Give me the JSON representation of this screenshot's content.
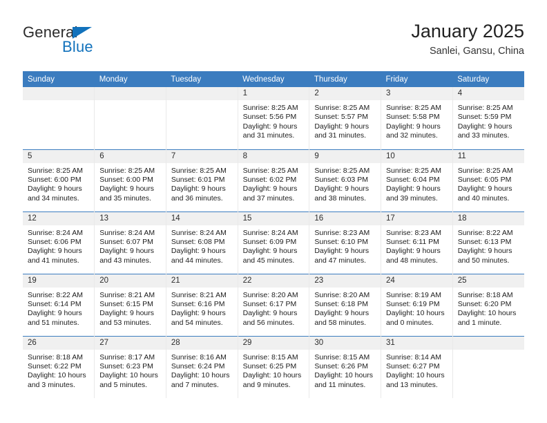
{
  "logo": {
    "text_primary": "General",
    "text_secondary": "Blue",
    "triangle_color": "#1272bc",
    "primary_color": "#2b2b2b"
  },
  "header": {
    "title": "January 2025",
    "subtitle": "Sanlei, Gansu, China"
  },
  "theme": {
    "header_blue": "#3b7cbf",
    "daynum_band": "#f0f0f0",
    "cell_divider": "#e9e9e9"
  },
  "weekday_headers": [
    "Sunday",
    "Monday",
    "Tuesday",
    "Wednesday",
    "Thursday",
    "Friday",
    "Saturday"
  ],
  "weeks": [
    [
      {
        "day": "",
        "sunrise": "",
        "sunset": "",
        "daylight1": "",
        "daylight2": "",
        "empty": true
      },
      {
        "day": "",
        "sunrise": "",
        "sunset": "",
        "daylight1": "",
        "daylight2": "",
        "empty": true
      },
      {
        "day": "",
        "sunrise": "",
        "sunset": "",
        "daylight1": "",
        "daylight2": "",
        "empty": true
      },
      {
        "day": "1",
        "sunrise": "Sunrise: 8:25 AM",
        "sunset": "Sunset: 5:56 PM",
        "daylight1": "Daylight: 9 hours",
        "daylight2": "and 31 minutes."
      },
      {
        "day": "2",
        "sunrise": "Sunrise: 8:25 AM",
        "sunset": "Sunset: 5:57 PM",
        "daylight1": "Daylight: 9 hours",
        "daylight2": "and 31 minutes."
      },
      {
        "day": "3",
        "sunrise": "Sunrise: 8:25 AM",
        "sunset": "Sunset: 5:58 PM",
        "daylight1": "Daylight: 9 hours",
        "daylight2": "and 32 minutes."
      },
      {
        "day": "4",
        "sunrise": "Sunrise: 8:25 AM",
        "sunset": "Sunset: 5:59 PM",
        "daylight1": "Daylight: 9 hours",
        "daylight2": "and 33 minutes."
      }
    ],
    [
      {
        "day": "5",
        "sunrise": "Sunrise: 8:25 AM",
        "sunset": "Sunset: 6:00 PM",
        "daylight1": "Daylight: 9 hours",
        "daylight2": "and 34 minutes."
      },
      {
        "day": "6",
        "sunrise": "Sunrise: 8:25 AM",
        "sunset": "Sunset: 6:00 PM",
        "daylight1": "Daylight: 9 hours",
        "daylight2": "and 35 minutes."
      },
      {
        "day": "7",
        "sunrise": "Sunrise: 8:25 AM",
        "sunset": "Sunset: 6:01 PM",
        "daylight1": "Daylight: 9 hours",
        "daylight2": "and 36 minutes."
      },
      {
        "day": "8",
        "sunrise": "Sunrise: 8:25 AM",
        "sunset": "Sunset: 6:02 PM",
        "daylight1": "Daylight: 9 hours",
        "daylight2": "and 37 minutes."
      },
      {
        "day": "9",
        "sunrise": "Sunrise: 8:25 AM",
        "sunset": "Sunset: 6:03 PM",
        "daylight1": "Daylight: 9 hours",
        "daylight2": "and 38 minutes."
      },
      {
        "day": "10",
        "sunrise": "Sunrise: 8:25 AM",
        "sunset": "Sunset: 6:04 PM",
        "daylight1": "Daylight: 9 hours",
        "daylight2": "and 39 minutes."
      },
      {
        "day": "11",
        "sunrise": "Sunrise: 8:25 AM",
        "sunset": "Sunset: 6:05 PM",
        "daylight1": "Daylight: 9 hours",
        "daylight2": "and 40 minutes."
      }
    ],
    [
      {
        "day": "12",
        "sunrise": "Sunrise: 8:24 AM",
        "sunset": "Sunset: 6:06 PM",
        "daylight1": "Daylight: 9 hours",
        "daylight2": "and 41 minutes."
      },
      {
        "day": "13",
        "sunrise": "Sunrise: 8:24 AM",
        "sunset": "Sunset: 6:07 PM",
        "daylight1": "Daylight: 9 hours",
        "daylight2": "and 43 minutes."
      },
      {
        "day": "14",
        "sunrise": "Sunrise: 8:24 AM",
        "sunset": "Sunset: 6:08 PM",
        "daylight1": "Daylight: 9 hours",
        "daylight2": "and 44 minutes."
      },
      {
        "day": "15",
        "sunrise": "Sunrise: 8:24 AM",
        "sunset": "Sunset: 6:09 PM",
        "daylight1": "Daylight: 9 hours",
        "daylight2": "and 45 minutes."
      },
      {
        "day": "16",
        "sunrise": "Sunrise: 8:23 AM",
        "sunset": "Sunset: 6:10 PM",
        "daylight1": "Daylight: 9 hours",
        "daylight2": "and 47 minutes."
      },
      {
        "day": "17",
        "sunrise": "Sunrise: 8:23 AM",
        "sunset": "Sunset: 6:11 PM",
        "daylight1": "Daylight: 9 hours",
        "daylight2": "and 48 minutes."
      },
      {
        "day": "18",
        "sunrise": "Sunrise: 8:22 AM",
        "sunset": "Sunset: 6:13 PM",
        "daylight1": "Daylight: 9 hours",
        "daylight2": "and 50 minutes."
      }
    ],
    [
      {
        "day": "19",
        "sunrise": "Sunrise: 8:22 AM",
        "sunset": "Sunset: 6:14 PM",
        "daylight1": "Daylight: 9 hours",
        "daylight2": "and 51 minutes."
      },
      {
        "day": "20",
        "sunrise": "Sunrise: 8:21 AM",
        "sunset": "Sunset: 6:15 PM",
        "daylight1": "Daylight: 9 hours",
        "daylight2": "and 53 minutes."
      },
      {
        "day": "21",
        "sunrise": "Sunrise: 8:21 AM",
        "sunset": "Sunset: 6:16 PM",
        "daylight1": "Daylight: 9 hours",
        "daylight2": "and 54 minutes."
      },
      {
        "day": "22",
        "sunrise": "Sunrise: 8:20 AM",
        "sunset": "Sunset: 6:17 PM",
        "daylight1": "Daylight: 9 hours",
        "daylight2": "and 56 minutes."
      },
      {
        "day": "23",
        "sunrise": "Sunrise: 8:20 AM",
        "sunset": "Sunset: 6:18 PM",
        "daylight1": "Daylight: 9 hours",
        "daylight2": "and 58 minutes."
      },
      {
        "day": "24",
        "sunrise": "Sunrise: 8:19 AM",
        "sunset": "Sunset: 6:19 PM",
        "daylight1": "Daylight: 10 hours",
        "daylight2": "and 0 minutes."
      },
      {
        "day": "25",
        "sunrise": "Sunrise: 8:18 AM",
        "sunset": "Sunset: 6:20 PM",
        "daylight1": "Daylight: 10 hours",
        "daylight2": "and 1 minute."
      }
    ],
    [
      {
        "day": "26",
        "sunrise": "Sunrise: 8:18 AM",
        "sunset": "Sunset: 6:22 PM",
        "daylight1": "Daylight: 10 hours",
        "daylight2": "and 3 minutes."
      },
      {
        "day": "27",
        "sunrise": "Sunrise: 8:17 AM",
        "sunset": "Sunset: 6:23 PM",
        "daylight1": "Daylight: 10 hours",
        "daylight2": "and 5 minutes."
      },
      {
        "day": "28",
        "sunrise": "Sunrise: 8:16 AM",
        "sunset": "Sunset: 6:24 PM",
        "daylight1": "Daylight: 10 hours",
        "daylight2": "and 7 minutes."
      },
      {
        "day": "29",
        "sunrise": "Sunrise: 8:15 AM",
        "sunset": "Sunset: 6:25 PM",
        "daylight1": "Daylight: 10 hours",
        "daylight2": "and 9 minutes."
      },
      {
        "day": "30",
        "sunrise": "Sunrise: 8:15 AM",
        "sunset": "Sunset: 6:26 PM",
        "daylight1": "Daylight: 10 hours",
        "daylight2": "and 11 minutes."
      },
      {
        "day": "31",
        "sunrise": "Sunrise: 8:14 AM",
        "sunset": "Sunset: 6:27 PM",
        "daylight1": "Daylight: 10 hours",
        "daylight2": "and 13 minutes."
      },
      {
        "day": "",
        "sunrise": "",
        "sunset": "",
        "daylight1": "",
        "daylight2": "",
        "empty": true
      }
    ]
  ]
}
